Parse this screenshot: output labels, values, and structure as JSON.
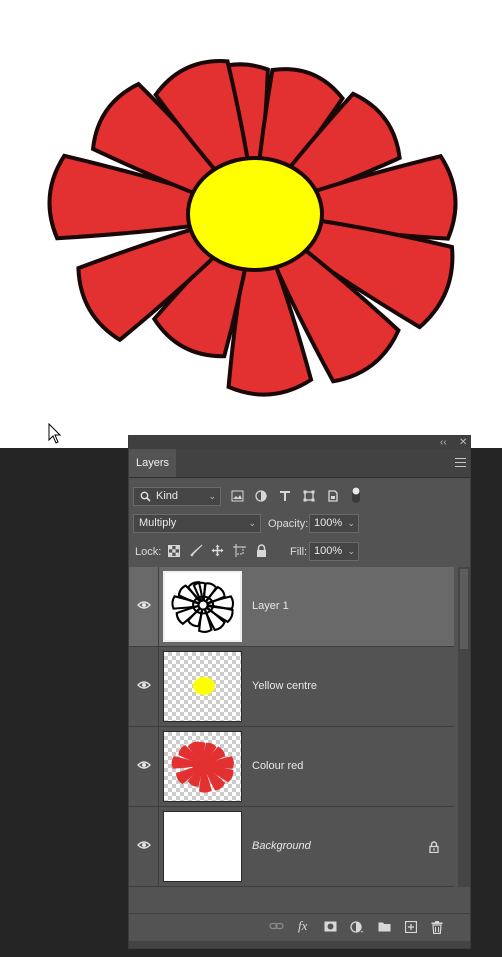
{
  "canvas": {
    "petal_color": "#e33030",
    "centre_color": "#ffff00",
    "outline_color": "#1a0808"
  },
  "panel": {
    "collapse_glyph": "‹‹",
    "close_glyph": "✕",
    "tab_label": "Layers",
    "filter": {
      "kind_label": "Kind",
      "filter_icons": [
        "image-filter-icon",
        "adjustment-filter-icon",
        "type-filter-icon",
        "shape-filter-icon",
        "smart-object-filter-icon",
        "filter-toggle-icon"
      ]
    },
    "blend": {
      "mode": "Multiply",
      "opacity_label": "Opacity:",
      "opacity_value": "100%"
    },
    "lock": {
      "label": "Lock:",
      "icons": [
        "lock-transparent-icon",
        "lock-image-icon",
        "lock-position-icon",
        "lock-artboard-icon",
        "lock-all-icon"
      ],
      "fill_label": "Fill:",
      "fill_value": "100%"
    },
    "layers": [
      {
        "name": "Layer 1",
        "thumbnail": "flower-outline",
        "selected": true,
        "visible": true,
        "locked": false
      },
      {
        "name": "Yellow centre",
        "thumbnail": "yellow-dot",
        "selected": false,
        "visible": true,
        "locked": false
      },
      {
        "name": "Colour red",
        "thumbnail": "red-flower",
        "selected": false,
        "visible": true,
        "locked": false
      },
      {
        "name": "Background",
        "thumbnail": "white",
        "selected": false,
        "visible": true,
        "locked": true
      }
    ],
    "footer_icons": [
      "link-layers-icon",
      "fx-icon",
      "add-mask-icon",
      "adjustment-layer-icon",
      "new-group-icon",
      "new-layer-icon",
      "delete-layer-icon"
    ]
  }
}
